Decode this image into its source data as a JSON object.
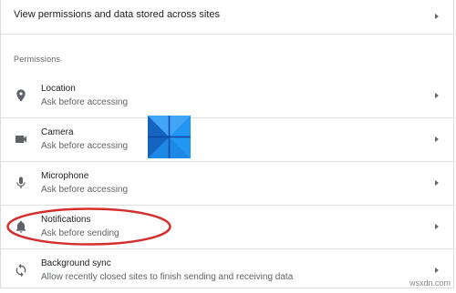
{
  "header_link": {
    "label": "View permissions and data stored across sites",
    "icon": "chevron-right-icon"
  },
  "permissions": {
    "heading": "Permissions",
    "items": [
      {
        "title": "Location",
        "subtitle": "Ask before accessing",
        "icon": "location-pin-icon"
      },
      {
        "title": "Camera",
        "subtitle": "Ask before accessing",
        "icon": "camera-icon"
      },
      {
        "title": "Microphone",
        "subtitle": "Ask before accessing",
        "icon": "microphone-icon"
      },
      {
        "title": "Notifications",
        "subtitle": "Ask before sending",
        "icon": "bell-icon"
      },
      {
        "title": "Background sync",
        "subtitle": "Allow recently closed sites to finish sending and receiving data",
        "icon": "sync-icon"
      }
    ]
  },
  "overlay": {
    "logo": "windows-logo",
    "highlight": "red-ellipse-around-notifications",
    "highlight_color": "#d32f2f"
  },
  "watermark": {
    "text": "wsxdn.com"
  },
  "colors": {
    "text": "#202124",
    "secondary_text": "#5f6368",
    "divider": "#e0e0e0",
    "logo_blue": "#1e88e5"
  }
}
